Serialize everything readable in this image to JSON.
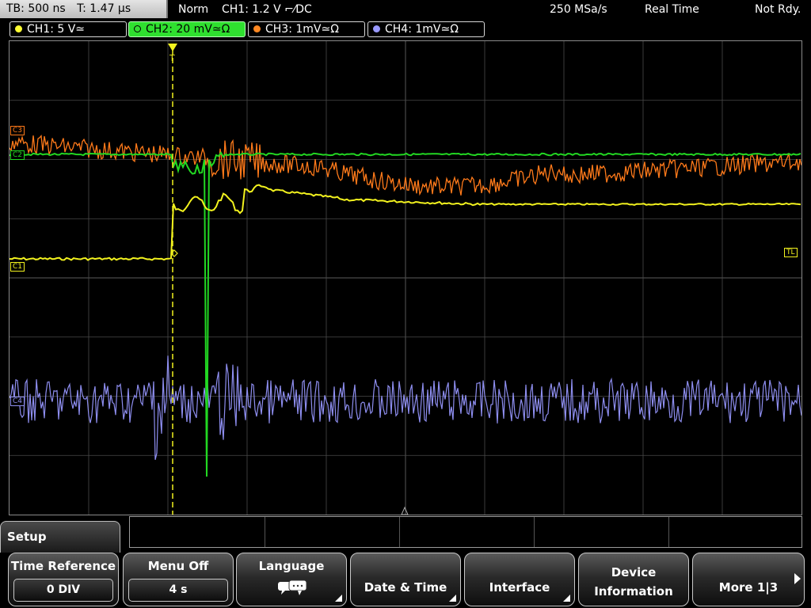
{
  "status_bar": {
    "timebase": "TB: 500 ns",
    "trigger_time": "T: 1.47 µs",
    "trigger_mode": "Norm",
    "trigger_info": "CH1: 1.2 V ⌐⁄DC",
    "sample_rate": "250 MSa/s",
    "acq_mode": "Real Time",
    "ready_state": "Not Rdy."
  },
  "channels": [
    {
      "label": "CH1: 5 V≃",
      "color": "#ffff33",
      "active": false
    },
    {
      "label": "CH2: 20 mV≃Ω",
      "color": "#33dd33",
      "active": true
    },
    {
      "label": "CH3: 1mV≃Ω",
      "color": "#ff8822",
      "active": false
    },
    {
      "label": "CH4: 1mV≃Ω",
      "color": "#9999ff",
      "active": false
    }
  ],
  "markers": {
    "c3": "C3",
    "c2": "C2",
    "c1": "C1",
    "c4": "C4",
    "trigger_level": "TL",
    "trigger_pos": "T"
  },
  "trace_colors": {
    "ch1": "#f2f21e",
    "ch2": "#22d822",
    "ch3": "#ff7a1a",
    "ch4": "#8e8ef0",
    "grid": "#4a4a4a",
    "trigger_line": "#f2f21e"
  },
  "menu": {
    "title": "Setup",
    "keys": [
      {
        "label": "Time Reference",
        "value": "0 DIV"
      },
      {
        "label": "Menu Off",
        "value": "4 s"
      },
      {
        "label": "Language",
        "icon": "speech-bubbles-icon"
      },
      {
        "label": "Date & Time"
      },
      {
        "label": "Interface"
      },
      {
        "label_line1": "Device",
        "label_line2": "Information"
      },
      {
        "label": "More 1|3"
      }
    ]
  }
}
